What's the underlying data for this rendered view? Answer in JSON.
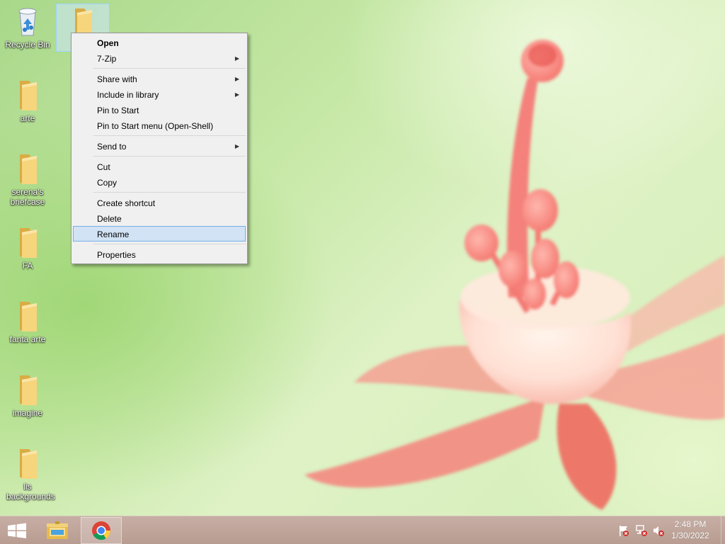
{
  "desktop": {
    "icons": [
      {
        "label": "Recycle Bin",
        "icon": "recycle-bin-icon"
      },
      {
        "label": "",
        "icon": "folder-icon",
        "selected": true
      },
      {
        "label": "arte",
        "icon": "folder-icon"
      },
      {
        "label": "serena's briefcase",
        "icon": "folder-icon"
      },
      {
        "label": "FA",
        "icon": "folder-icon"
      },
      {
        "label": "fanta arte",
        "icon": "folder-icon"
      },
      {
        "label": "imagine",
        "icon": "folder-icon"
      },
      {
        "label": "lis backgrounds",
        "icon": "folder-icon"
      }
    ]
  },
  "context_menu": {
    "items": [
      {
        "label": "Open",
        "bold": true
      },
      {
        "label": "7-Zip",
        "submenu": true
      },
      {
        "label": "Share with",
        "submenu": true
      },
      {
        "label": "Include in library",
        "submenu": true
      },
      {
        "label": "Pin to Start"
      },
      {
        "label": "Pin to Start menu (Open-Shell)"
      },
      {
        "label": "Send to",
        "submenu": true
      },
      {
        "label": "Cut"
      },
      {
        "label": "Copy"
      },
      {
        "label": "Create shortcut"
      },
      {
        "label": "Delete"
      },
      {
        "label": "Rename",
        "highlighted": true
      },
      {
        "label": "Properties"
      }
    ],
    "submenu_arrow": "▶"
  },
  "taskbar": {
    "start_icon": "windows-logo-icon",
    "pinned": [
      {
        "name": "File Explorer",
        "icon": "file-explorer-icon"
      },
      {
        "name": "Google Chrome",
        "icon": "chrome-icon",
        "active": true
      }
    ],
    "tray": [
      {
        "icon": "action-center-flag-icon"
      },
      {
        "icon": "network-icon"
      },
      {
        "icon": "volume-muted-icon"
      }
    ],
    "clock": {
      "time": "2:48 PM",
      "date": "1/30/2022"
    }
  },
  "colors": {
    "menu_background": "#f0f0f0",
    "menu_highlight": "#d1e3f5",
    "menu_highlight_border": "#78aee5",
    "taskbar": "#bfa59b",
    "folder": "#f3d27a"
  }
}
